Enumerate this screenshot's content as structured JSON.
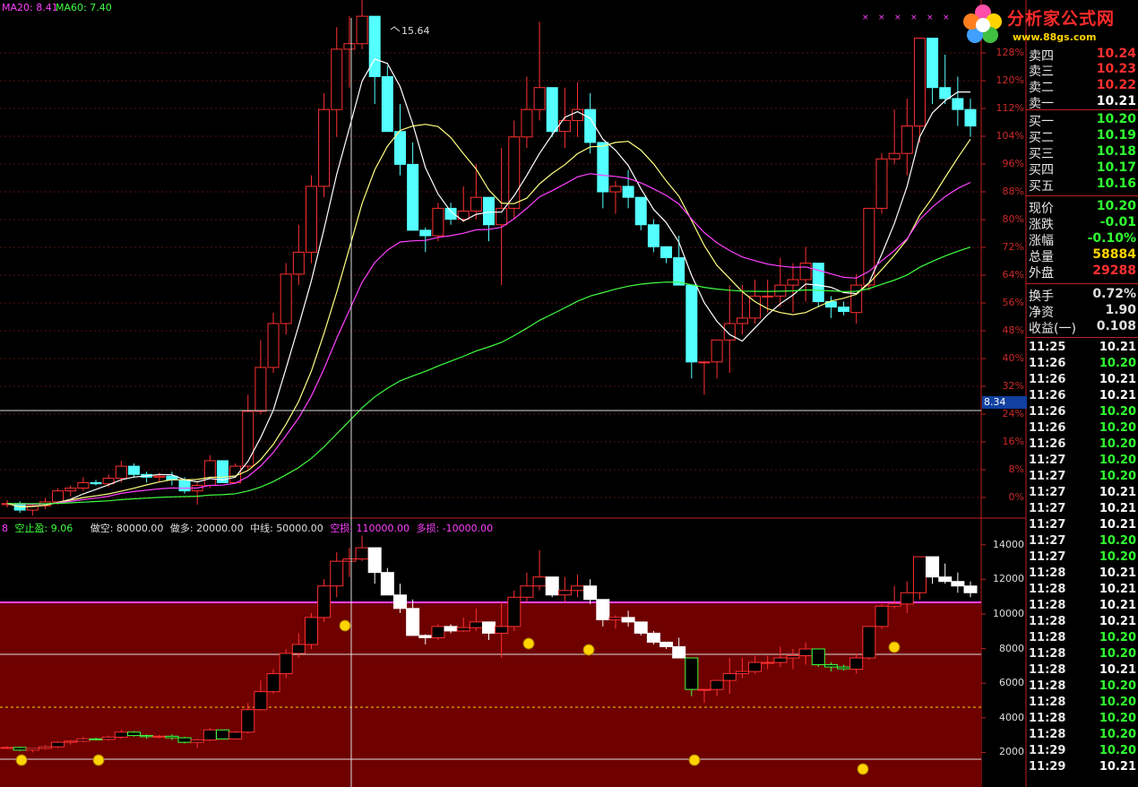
{
  "top_indicators": [
    {
      "text": "MA20: 8.41",
      "color": "#ff40ff"
    },
    {
      "text": "MA60: 7.40",
      "color": "#40ff40"
    }
  ],
  "logo": {
    "cn": "分析家公式网",
    "url": "www.88gs.com"
  },
  "peak_label": "15.64",
  "crosshair_price": "8.34",
  "pct_axis": [
    "128%",
    "120%",
    "112%",
    "104%",
    "96%",
    "88%",
    "80%",
    "72%",
    "64%",
    "56%",
    "48%",
    "40%",
    "32%",
    "24%",
    "16%",
    "8%",
    "0%"
  ],
  "vol_axis": [
    "14000",
    "12000",
    "10000",
    "8000",
    "6000",
    "4000",
    "2000"
  ],
  "indicator_line": [
    {
      "text": "8",
      "color": "#ff40ff"
    },
    {
      "text": "空止盈: 9.06",
      "color": "#40ff40"
    },
    {
      "text": "做空: 80000.00",
      "color": "#e0e0e0"
    },
    {
      "text": "做多: 20000.00",
      "color": "#e0e0e0"
    },
    {
      "text": "中线: 50000.00",
      "color": "#e0e0e0"
    },
    {
      "text": "空损: 110000.00",
      "color": "#ff40ff"
    },
    {
      "text": "多损: -10000.00",
      "color": "#ff40ff"
    }
  ],
  "panel": [
    {
      "label": "卖四",
      "value": "10.24",
      "color": "#ff3030"
    },
    {
      "label": "卖三",
      "value": "10.23",
      "color": "#ff3030"
    },
    {
      "label": "卖二",
      "value": "10.22",
      "color": "#ff3030"
    },
    {
      "label": "卖一",
      "value": "10.21",
      "color": "#ffffff"
    },
    {
      "label": "买一",
      "value": "10.20",
      "color": "#30ff30"
    },
    {
      "label": "买二",
      "value": "10.19",
      "color": "#30ff30"
    },
    {
      "label": "买三",
      "value": "10.18",
      "color": "#30ff30"
    },
    {
      "label": "买四",
      "value": "10.17",
      "color": "#30ff30"
    },
    {
      "label": "买五",
      "value": "10.16",
      "color": "#30ff30"
    },
    {
      "label": "现价",
      "value": "10.20",
      "color": "#30ff30"
    },
    {
      "label": "涨跌",
      "value": "-0.01",
      "color": "#30ff30"
    },
    {
      "label": "涨幅",
      "value": "-0.10%",
      "color": "#30ff30"
    },
    {
      "label": "总量",
      "value": "58884",
      "color": "#ffd400"
    },
    {
      "label": "外盘",
      "value": "29288",
      "color": "#ff3030"
    },
    {
      "label": "换手",
      "value": "0.72%",
      "color": "#e0e0e0"
    },
    {
      "label": "净资",
      "value": "1.90",
      "color": "#e0e0e0"
    },
    {
      "label": "收益(一)",
      "value": "0.108",
      "color": "#e0e0e0"
    }
  ],
  "trades": [
    {
      "time": "11:25",
      "price": "10.21",
      "color": "#ffffff"
    },
    {
      "time": "11:26",
      "price": "10.20",
      "color": "#30ff30"
    },
    {
      "time": "11:26",
      "price": "10.21",
      "color": "#ffffff"
    },
    {
      "time": "11:26",
      "price": "10.21",
      "color": "#ffffff"
    },
    {
      "time": "11:26",
      "price": "10.20",
      "color": "#30ff30"
    },
    {
      "time": "11:26",
      "price": "10.20",
      "color": "#30ff30"
    },
    {
      "time": "11:26",
      "price": "10.20",
      "color": "#30ff30"
    },
    {
      "time": "11:27",
      "price": "10.20",
      "color": "#30ff30"
    },
    {
      "time": "11:27",
      "price": "10.20",
      "color": "#30ff30"
    },
    {
      "time": "11:27",
      "price": "10.21",
      "color": "#ffffff"
    },
    {
      "time": "11:27",
      "price": "10.21",
      "color": "#ffffff"
    },
    {
      "time": "11:27",
      "price": "10.21",
      "color": "#ffffff"
    },
    {
      "time": "11:27",
      "price": "10.20",
      "color": "#30ff30"
    },
    {
      "time": "11:27",
      "price": "10.20",
      "color": "#30ff30"
    },
    {
      "time": "11:28",
      "price": "10.21",
      "color": "#ffffff"
    },
    {
      "time": "11:28",
      "price": "10.21",
      "color": "#ffffff"
    },
    {
      "time": "11:28",
      "price": "10.21",
      "color": "#ffffff"
    },
    {
      "time": "11:28",
      "price": "10.21",
      "color": "#ffffff"
    },
    {
      "time": "11:28",
      "price": "10.20",
      "color": "#30ff30"
    },
    {
      "time": "11:28",
      "price": "10.20",
      "color": "#30ff30"
    },
    {
      "time": "11:28",
      "price": "10.21",
      "color": "#ffffff"
    },
    {
      "time": "11:28",
      "price": "10.20",
      "color": "#30ff30"
    },
    {
      "time": "11:28",
      "price": "10.20",
      "color": "#30ff30"
    },
    {
      "time": "11:28",
      "price": "10.20",
      "color": "#30ff30"
    },
    {
      "time": "11:28",
      "price": "10.20",
      "color": "#30ff30"
    },
    {
      "time": "11:29",
      "price": "10.20",
      "color": "#30ff30"
    },
    {
      "time": "11:29",
      "price": "10.21",
      "color": "#ffffff"
    }
  ],
  "chart_data": {
    "type": "candlestick",
    "price_candles": [
      [
        6.2,
        6.28,
        6.15,
        6.22
      ],
      [
        6.22,
        6.26,
        6.05,
        6.1
      ],
      [
        6.1,
        6.2,
        6.0,
        6.18
      ],
      [
        6.18,
        6.32,
        6.12,
        6.25
      ],
      [
        6.25,
        6.5,
        6.2,
        6.45
      ],
      [
        6.45,
        6.55,
        6.35,
        6.5
      ],
      [
        6.5,
        6.7,
        6.45,
        6.6
      ],
      [
        6.6,
        6.65,
        6.55,
        6.58
      ],
      [
        6.58,
        6.75,
        6.52,
        6.68
      ],
      [
        6.68,
        7.0,
        6.6,
        6.9
      ],
      [
        6.9,
        6.95,
        6.7,
        6.75
      ],
      [
        6.75,
        6.8,
        6.6,
        6.7
      ],
      [
        6.7,
        6.78,
        6.62,
        6.72
      ],
      [
        6.72,
        6.8,
        6.55,
        6.65
      ],
      [
        6.65,
        6.7,
        6.4,
        6.45
      ],
      [
        6.45,
        6.6,
        6.2,
        6.55
      ],
      [
        6.55,
        7.1,
        6.5,
        7.0
      ],
      [
        7.0,
        6.98,
        6.6,
        6.6
      ],
      [
        6.6,
        6.95,
        6.58,
        6.9
      ],
      [
        6.9,
        8.2,
        6.85,
        7.9
      ],
      [
        7.9,
        9.2,
        7.85,
        8.7
      ],
      [
        8.7,
        9.7,
        8.6,
        9.5
      ],
      [
        9.5,
        10.6,
        9.3,
        10.4
      ],
      [
        10.4,
        11.3,
        10.2,
        10.8
      ],
      [
        10.8,
        12.2,
        10.6,
        12.0
      ],
      [
        12.0,
        13.7,
        11.8,
        13.4
      ],
      [
        13.4,
        14.9,
        12.9,
        14.5
      ],
      [
        14.5,
        15.1,
        13.8,
        14.6
      ],
      [
        14.6,
        15.64,
        14.5,
        15.1
      ],
      [
        15.1,
        14.8,
        13.5,
        14.0
      ],
      [
        14.0,
        14.2,
        13.0,
        13.0
      ],
      [
        13.0,
        13.5,
        12.2,
        12.4
      ],
      [
        12.4,
        12.8,
        11.3,
        11.2
      ],
      [
        11.2,
        11.25,
        10.8,
        11.1
      ],
      [
        11.1,
        11.7,
        11.0,
        11.6
      ],
      [
        11.6,
        11.7,
        11.3,
        11.4
      ],
      [
        11.4,
        12.0,
        11.35,
        11.55
      ],
      [
        11.55,
        12.4,
        11.4,
        11.8
      ],
      [
        11.8,
        11.7,
        11.0,
        11.3
      ],
      [
        11.3,
        12.7,
        10.2,
        11.6
      ],
      [
        11.6,
        13.2,
        11.4,
        12.9
      ],
      [
        12.9,
        14.0,
        12.7,
        13.4
      ],
      [
        13.4,
        15.0,
        13.2,
        13.8
      ],
      [
        13.8,
        13.6,
        12.9,
        13.0
      ],
      [
        13.0,
        13.8,
        12.7,
        13.2
      ],
      [
        13.2,
        13.9,
        12.9,
        13.4
      ],
      [
        13.4,
        13.7,
        12.6,
        12.8
      ],
      [
        12.8,
        12.75,
        11.6,
        11.9
      ],
      [
        11.9,
        12.1,
        11.5,
        12.0
      ],
      [
        12.0,
        12.3,
        11.6,
        11.8
      ],
      [
        11.8,
        11.75,
        11.2,
        11.3
      ],
      [
        11.3,
        11.4,
        10.8,
        10.9
      ],
      [
        10.9,
        10.8,
        10.6,
        10.7
      ],
      [
        10.7,
        11.1,
        10.4,
        10.2
      ],
      [
        10.2,
        10.2,
        8.5,
        8.8
      ],
      [
        8.8,
        8.82,
        8.2,
        8.8
      ],
      [
        8.8,
        9.0,
        8.5,
        9.2
      ],
      [
        9.2,
        10.2,
        8.6,
        9.5
      ],
      [
        9.5,
        10.2,
        9.3,
        9.6
      ],
      [
        9.6,
        10.3,
        9.5,
        10.0
      ],
      [
        10.0,
        10.3,
        9.7,
        10.0
      ],
      [
        10.0,
        10.7,
        9.8,
        10.2
      ],
      [
        10.2,
        10.6,
        9.7,
        10.3
      ],
      [
        10.3,
        10.9,
        9.9,
        10.6
      ],
      [
        10.6,
        10.6,
        9.8,
        9.9
      ],
      [
        9.9,
        10.0,
        9.6,
        9.8
      ],
      [
        9.8,
        9.9,
        9.65,
        9.72
      ],
      [
        9.7,
        10.4,
        9.5,
        10.2
      ],
      [
        10.2,
        11.2,
        10.1,
        11.6
      ],
      [
        11.6,
        12.6,
        11.5,
        12.5
      ],
      [
        12.5,
        13.4,
        12.4,
        12.6
      ],
      [
        12.6,
        13.6,
        12.2,
        13.1
      ],
      [
        13.1,
        14.7,
        12.8,
        14.7
      ],
      [
        14.7,
        14.5,
        13.5,
        13.8
      ],
      [
        13.8,
        14.4,
        13.5,
        13.6
      ],
      [
        13.6,
        14.0,
        13.1,
        13.4
      ],
      [
        13.4,
        13.6,
        12.9,
        13.1
      ]
    ],
    "ma20_latest": 8.41,
    "ma60_latest": 7.4,
    "peak": 15.64,
    "pct_axis_range": [
      0,
      128
    ],
    "indicator_axis_range": [
      2000,
      14000
    ],
    "indicator_levels": {
      "做空": 80000.0,
      "做多": 20000.0,
      "中线": 50000.0,
      "空损": 110000.0,
      "多损": -10000.0
    },
    "indicator_line_values": {
      "空止盈": 9.06
    }
  }
}
